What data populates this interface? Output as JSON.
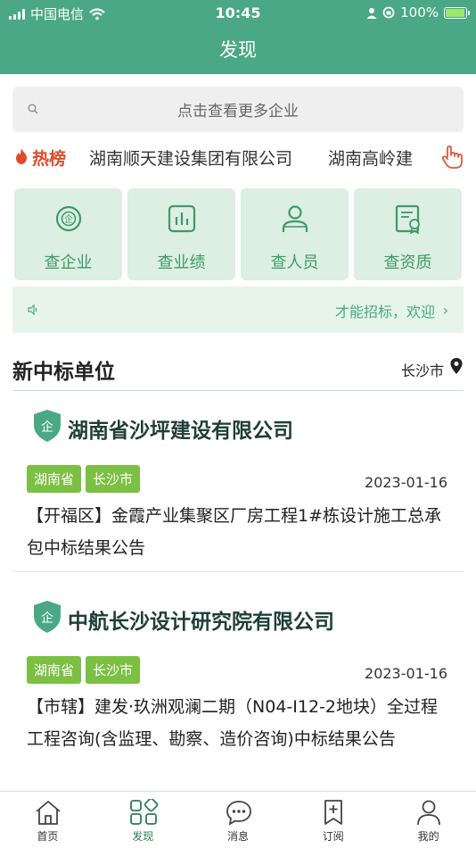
{
  "status_bar": {
    "carrier": "中国电信",
    "time": "10:45",
    "battery": "100%"
  },
  "header": {
    "title": "发现"
  },
  "search": {
    "placeholder": "点击查看更多企业"
  },
  "hot": {
    "label": "热榜",
    "items": [
      "湖南顺天建设集团有限公司",
      "湖南高岭建"
    ]
  },
  "menu": [
    {
      "label": "查企业",
      "icon": "enterprise-icon"
    },
    {
      "label": "查业绩",
      "icon": "performance-chart-icon"
    },
    {
      "label": "查人员",
      "icon": "person-icon"
    },
    {
      "label": "查资质",
      "icon": "certificate-icon"
    }
  ],
  "notice": {
    "text": "才能招标，欢迎",
    "icon": "speaker-icon"
  },
  "section": {
    "title": "新中标单位",
    "city": "长沙市"
  },
  "cards": [
    {
      "company": "湖南省沙坪建设有限公司",
      "badge": "企",
      "tags": [
        "湖南省",
        "长沙市"
      ],
      "date": "2023-01-16",
      "desc": "【开福区】金霞产业集聚区厂房工程1#栋设计施工总承包中标结果公告"
    },
    {
      "company": "中航长沙设计研究院有限公司",
      "badge": "企",
      "tags": [
        "湖南省",
        "长沙市"
      ],
      "date": "2023-01-16",
      "desc": "【市辖】建发·玖洲观澜二期（N04-I12-2地块）全过程工程咨询(含监理、勘察、造价咨询)中标结果公告"
    }
  ],
  "tabs": [
    {
      "label": "首页",
      "icon": "home-icon",
      "active": false
    },
    {
      "label": "发现",
      "icon": "discover-icon",
      "active": true
    },
    {
      "label": "消息",
      "icon": "message-icon",
      "active": false
    },
    {
      "label": "订阅",
      "icon": "subscribe-icon",
      "active": false
    },
    {
      "label": "我的",
      "icon": "profile-icon",
      "active": false
    }
  ],
  "colors": {
    "primary": "#4aa887",
    "tile_bg": "#dcefe2",
    "tag_bg": "#7bbf43",
    "hot": "#e04a2a"
  }
}
